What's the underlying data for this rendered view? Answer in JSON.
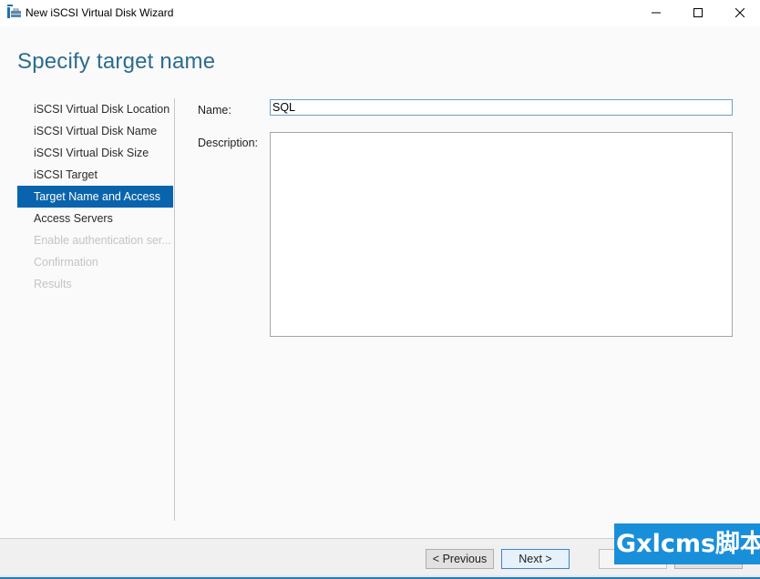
{
  "window": {
    "title": "New iSCSI Virtual Disk Wizard",
    "controls": {
      "minimize": "minimize-icon",
      "maximize": "maximize-icon",
      "close": "close-icon"
    }
  },
  "page": {
    "title": "Specify target name"
  },
  "nav": {
    "items": [
      {
        "label": "iSCSI Virtual Disk Location",
        "state": "completed"
      },
      {
        "label": "iSCSI Virtual Disk Name",
        "state": "completed"
      },
      {
        "label": "iSCSI Virtual Disk Size",
        "state": "completed"
      },
      {
        "label": "iSCSI Target",
        "state": "completed"
      },
      {
        "label": "Target Name and Access",
        "state": "active"
      },
      {
        "label": "Access Servers",
        "state": "enabled"
      },
      {
        "label": "Enable authentication ser...",
        "state": "disabled"
      },
      {
        "label": "Confirmation",
        "state": "disabled"
      },
      {
        "label": "Results",
        "state": "disabled"
      }
    ]
  },
  "form": {
    "name_label": "Name:",
    "name_value": "SQL",
    "description_label": "Description:",
    "description_value": ""
  },
  "footer": {
    "previous_label": "< Previous",
    "next_label": "Next >"
  },
  "watermark": {
    "text": "Gxlcms脚本"
  },
  "colors": {
    "accent": "#0a64ad",
    "title": "#2b6c8f",
    "watermark": "#1a8fd9"
  }
}
